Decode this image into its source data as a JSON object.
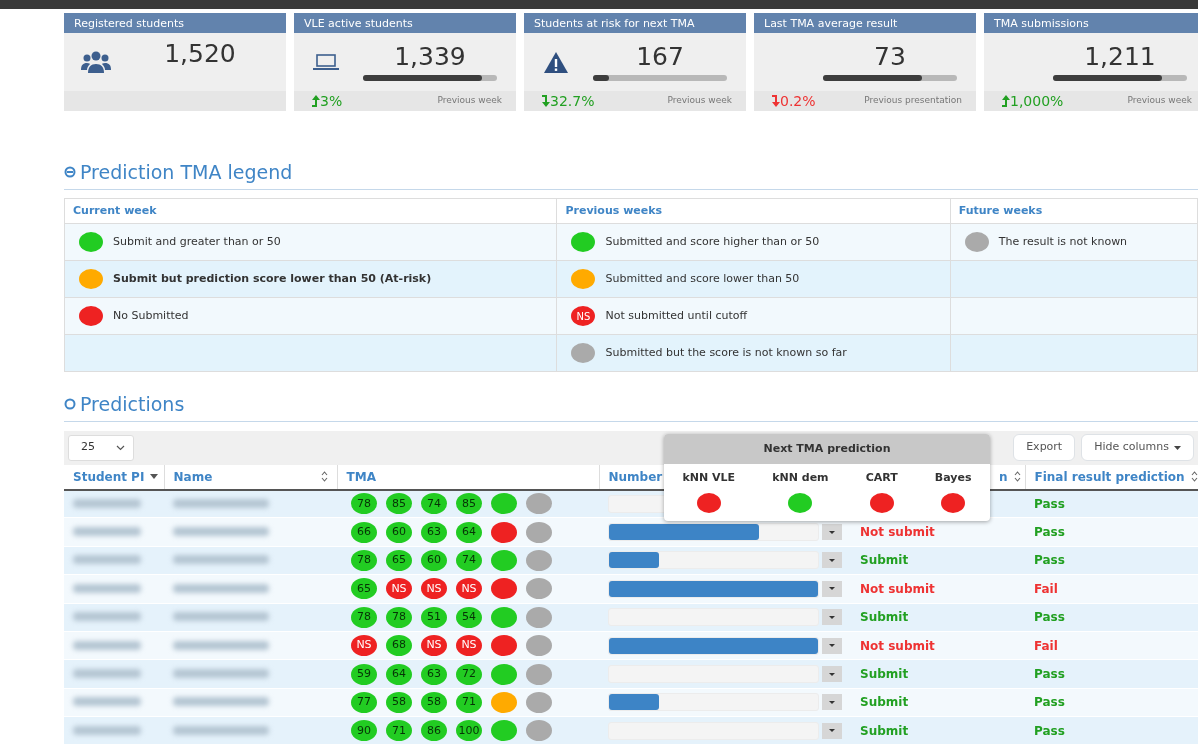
{
  "kpis": [
    {
      "title": "Registered students",
      "kind": "users",
      "value": "1,520"
    },
    {
      "title": "VLE active students",
      "kind": "laptop",
      "value": "1,339",
      "level": 0.89,
      "change": "3%",
      "rising": true,
      "positive": true,
      "note": "Previous week"
    },
    {
      "title": "Students at risk for next TMA",
      "kind": "warning",
      "value": "167",
      "level": 0.12,
      "change": "32.7%",
      "rising": false,
      "positive": true,
      "note": "Previous week"
    },
    {
      "title": "Last TMA average result",
      "value": "73",
      "level": 0.74,
      "change": "0.2%",
      "rising": false,
      "positive": false,
      "note": "Previous presentation"
    },
    {
      "title": "TMA submissions",
      "value": "1,211",
      "level": 0.81,
      "change": "1,000%",
      "rising": true,
      "positive": true,
      "note": "Previous week"
    }
  ],
  "legend": {
    "title": "Prediction TMA legend",
    "columns": [
      "Current week",
      "Previous weeks",
      "Future weeks"
    ],
    "rows": [
      [
        {
          "color": "#22cc22",
          "text": "Submit and greater than or 50"
        },
        {
          "color": "#22cc22",
          "text": "Submitted and score higher than or 50"
        },
        {
          "color": "#aaaaaa",
          "text": "The result is not known"
        }
      ],
      [
        {
          "color": "#ffaa00",
          "text": "Submit but prediction score lower than 50 (At-risk)",
          "bold": true
        },
        {
          "color": "#ffaa00",
          "text": "Submitted and score lower than 50"
        },
        null
      ],
      [
        {
          "color": "#ee2222",
          "text": "No Submitted"
        },
        {
          "color": "#ee2222",
          "label": "NS",
          "text": "Not submitted until cutoff"
        },
        null
      ],
      [
        null,
        {
          "color": "#aaaaaa",
          "text": "Submitted but the score is not known so far"
        },
        null
      ]
    ]
  },
  "predictions": {
    "title": "Predictions",
    "page_size": "25",
    "buttons": [
      "Export",
      "Hide columns"
    ],
    "columns": [
      {
        "label": "Student PI",
        "sorted": true
      },
      {
        "label": "Name",
        "sortable": true
      },
      {
        "label": "TMA"
      },
      {
        "label": "Number"
      },
      {
        "label": "n",
        "sortable": true
      },
      {
        "label": "Final result prediction",
        "sortable": true
      }
    ],
    "rows": [
      {
        "tma": [
          {
            "label": "78",
            "color": "#22cc22"
          },
          {
            "label": "85",
            "color": "#22cc22"
          },
          {
            "label": "74",
            "color": "#22cc22"
          },
          {
            "label": "85",
            "color": "#22cc22"
          },
          {
            "color": "#22cc22"
          },
          {
            "color": "#aaaaaa"
          }
        ],
        "final": "Pass",
        "final_positive": true
      },
      {
        "tma": [
          {
            "label": "66",
            "color": "#22cc22"
          },
          {
            "label": "60",
            "color": "#22cc22"
          },
          {
            "label": "63",
            "color": "#22cc22"
          },
          {
            "label": "64",
            "color": "#22cc22"
          },
          {
            "color": "#ee2222"
          },
          {
            "color": "#aaaaaa"
          }
        ],
        "level": 0.72,
        "next": "Not submit",
        "next_positive": false,
        "final": "Pass",
        "final_positive": true
      },
      {
        "tma": [
          {
            "label": "78",
            "color": "#22cc22"
          },
          {
            "label": "65",
            "color": "#22cc22"
          },
          {
            "label": "60",
            "color": "#22cc22"
          },
          {
            "label": "74",
            "color": "#22cc22"
          },
          {
            "color": "#22cc22"
          },
          {
            "color": "#aaaaaa"
          }
        ],
        "level": 0.24,
        "next": "Submit",
        "next_positive": true,
        "final": "Pass",
        "final_positive": true
      },
      {
        "tma": [
          {
            "label": "65",
            "color": "#22cc22"
          },
          {
            "label": "NS",
            "color": "#ee2222"
          },
          {
            "label": "NS",
            "color": "#ee2222"
          },
          {
            "label": "NS",
            "color": "#ee2222"
          },
          {
            "color": "#ee2222"
          },
          {
            "color": "#aaaaaa"
          }
        ],
        "level": 1,
        "next": "Not submit",
        "next_positive": false,
        "final": "Fail",
        "final_positive": false
      },
      {
        "tma": [
          {
            "label": "78",
            "color": "#22cc22"
          },
          {
            "label": "78",
            "color": "#22cc22"
          },
          {
            "label": "51",
            "color": "#22cc22"
          },
          {
            "label": "54",
            "color": "#22cc22"
          },
          {
            "color": "#22cc22"
          },
          {
            "color": "#aaaaaa"
          }
        ],
        "next": "Submit",
        "next_positive": true,
        "final": "Pass",
        "final_positive": true
      },
      {
        "tma": [
          {
            "label": "NS",
            "color": "#ee2222"
          },
          {
            "label": "68",
            "color": "#22cc22"
          },
          {
            "label": "NS",
            "color": "#ee2222"
          },
          {
            "label": "NS",
            "color": "#ee2222"
          },
          {
            "color": "#ee2222"
          },
          {
            "color": "#aaaaaa"
          }
        ],
        "level": 1,
        "next": "Not submit",
        "next_positive": false,
        "final": "Fail",
        "final_positive": false
      },
      {
        "tma": [
          {
            "label": "59",
            "color": "#22cc22"
          },
          {
            "label": "64",
            "color": "#22cc22"
          },
          {
            "label": "63",
            "color": "#22cc22"
          },
          {
            "label": "72",
            "color": "#22cc22"
          },
          {
            "color": "#22cc22"
          },
          {
            "color": "#aaaaaa"
          }
        ],
        "next": "Submit",
        "next_positive": true,
        "final": "Pass",
        "final_positive": true
      },
      {
        "tma": [
          {
            "label": "77",
            "color": "#22cc22"
          },
          {
            "label": "58",
            "color": "#22cc22"
          },
          {
            "label": "58",
            "color": "#22cc22"
          },
          {
            "label": "71",
            "color": "#22cc22"
          },
          {
            "color": "#ffaa00"
          },
          {
            "color": "#aaaaaa"
          }
        ],
        "level": 0.24,
        "next": "Submit",
        "next_positive": true,
        "final": "Pass",
        "final_positive": true
      },
      {
        "tma": [
          {
            "label": "90",
            "color": "#22cc22"
          },
          {
            "label": "71",
            "color": "#22cc22"
          },
          {
            "label": "86",
            "color": "#22cc22"
          },
          {
            "label": "100",
            "color": "#22cc22"
          },
          {
            "color": "#22cc22"
          },
          {
            "color": "#aaaaaa"
          }
        ],
        "next": "Submit",
        "next_positive": true,
        "final": "Pass",
        "final_positive": true
      }
    ],
    "popup": {
      "title": "Next TMA prediction",
      "models": [
        {
          "name": "kNN VLE",
          "color": "#ee2222"
        },
        {
          "name": "kNN dem",
          "color": "#22cc22"
        },
        {
          "name": "CART",
          "color": "#ee2222"
        },
        {
          "name": "Bayes",
          "color": "#ee2222"
        }
      ]
    }
  }
}
